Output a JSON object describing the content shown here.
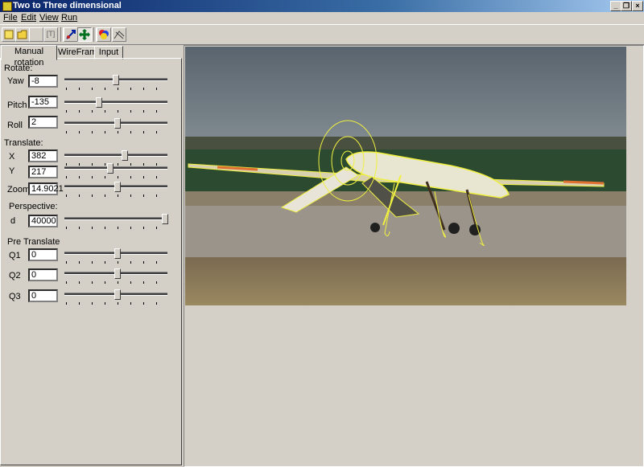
{
  "window": {
    "title": "Two to Three dimensional"
  },
  "menu": [
    "File",
    "Edit",
    "View",
    "Run"
  ],
  "toolbar": {
    "icons": [
      "new-icon",
      "open-icon",
      "blank-icon",
      "text-box-icon",
      "move-icon",
      "cross-arrows-icon",
      "color-icon",
      "wireframe-icon"
    ],
    "text_button_label": "[T]"
  },
  "tabs": [
    "Manual rotation",
    "WireFrame",
    "Input"
  ],
  "rotate": {
    "heading": "Rotate:",
    "fields": [
      {
        "label": "Yaw",
        "value": "-8"
      },
      {
        "label": "Pitch",
        "value": "-135"
      },
      {
        "label": "Roll",
        "value": "2"
      }
    ]
  },
  "translate": {
    "heading": "Translate:",
    "fields": [
      {
        "label": "X",
        "value": "382"
      },
      {
        "label": "Y",
        "value": "217"
      },
      {
        "label": "Zoom",
        "value": "14.9021"
      }
    ]
  },
  "perspective": {
    "heading": "Perspective:",
    "field": {
      "label": "d",
      "value": "40000"
    }
  },
  "pre_translate": {
    "heading": "Pre Translate",
    "fields": [
      {
        "label": "Q1",
        "value": "0"
      },
      {
        "label": "Q2",
        "value": "0"
      },
      {
        "label": "Q3",
        "value": "0"
      }
    ]
  },
  "colors": {
    "title_bar": "#0a246a",
    "wireframe": "#f0f040",
    "sky": "#5d6670"
  }
}
